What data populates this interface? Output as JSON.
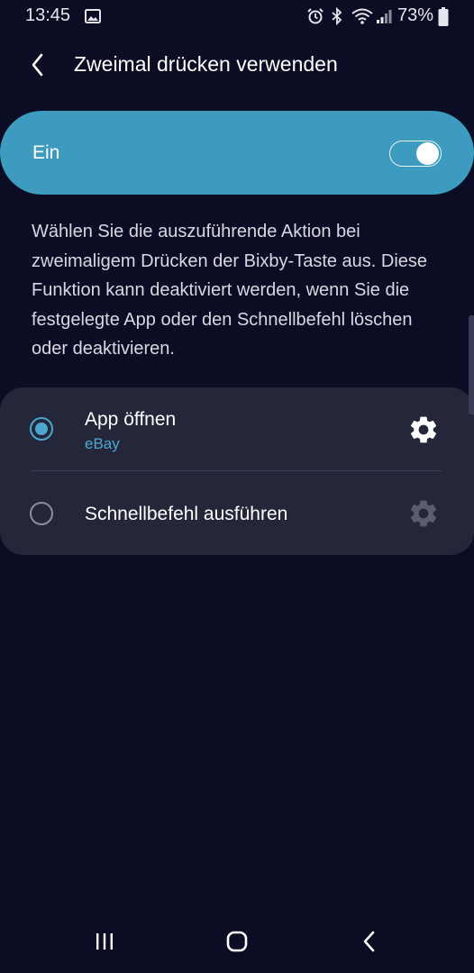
{
  "status_bar": {
    "time": "13:45",
    "battery": "73%",
    "icons": [
      "image-icon",
      "alarm-icon",
      "bluetooth-icon",
      "wifi-icon",
      "signal-icon",
      "battery-icon"
    ]
  },
  "header": {
    "back_icon": "back-arrow-icon",
    "title": "Zweimal drücken verwenden"
  },
  "master_switch": {
    "label": "Ein",
    "state": "on",
    "color": "#3d9bbf"
  },
  "description": "Wählen Sie die auszuführende Aktion bei zweimaligem Drücken der Bixby-Taste aus. Diese Funktion kann deaktiviert werden, wenn Sie die festgelegte App oder den Schnellbefehl löschen oder deaktivieren.",
  "options": [
    {
      "label": "App öffnen",
      "subtitle": "eBay",
      "selected": true,
      "settings_icon": "gear-icon"
    },
    {
      "label": "Schnellbefehl ausführen",
      "selected": false,
      "settings_icon": "gear-icon"
    }
  ],
  "accent_color": "#4ba7d2",
  "nav_bar": {
    "icons": [
      "recent-apps-icon",
      "home-icon",
      "back-icon"
    ]
  }
}
